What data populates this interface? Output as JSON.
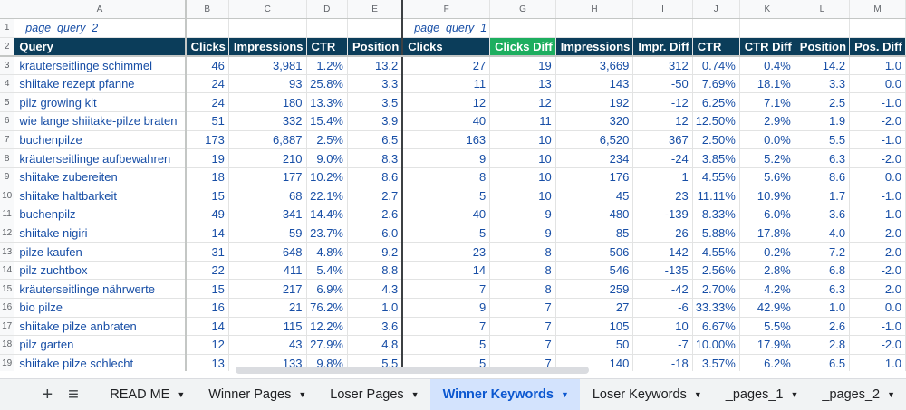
{
  "columns": [
    "A",
    "B",
    "C",
    "D",
    "E",
    "F",
    "G",
    "H",
    "I",
    "J",
    "K",
    "L",
    "M"
  ],
  "row_numbers": [
    "1",
    "2",
    "3",
    "4",
    "5",
    "6",
    "7",
    "8",
    "9",
    "10",
    "11",
    "12",
    "13",
    "14",
    "15",
    "16",
    "17",
    "18",
    "19"
  ],
  "labels": {
    "left": "_page_query_2",
    "right": "_page_query_1"
  },
  "headers": [
    "Query",
    "Clicks",
    "Impressions",
    "CTR",
    "Position",
    "Clicks",
    "Clicks Diff",
    "Impressions",
    "Impr. Diff",
    "CTR",
    "CTR Diff",
    "Position",
    "Pos. Diff"
  ],
  "rows": [
    [
      "kräuterseitlinge schimmel",
      "46",
      "3,981",
      "1.2%",
      "13.2",
      "27",
      "19",
      "3,669",
      "312",
      "0.74%",
      "0.4%",
      "14.2",
      "1.0"
    ],
    [
      "shiitake rezept pfanne",
      "24",
      "93",
      "25.8%",
      "3.3",
      "11",
      "13",
      "143",
      "-50",
      "7.69%",
      "18.1%",
      "3.3",
      "0.0"
    ],
    [
      "pilz growing kit",
      "24",
      "180",
      "13.3%",
      "3.5",
      "12",
      "12",
      "192",
      "-12",
      "6.25%",
      "7.1%",
      "2.5",
      "-1.0"
    ],
    [
      "wie lange shiitake-pilze braten",
      "51",
      "332",
      "15.4%",
      "3.9",
      "40",
      "11",
      "320",
      "12",
      "12.50%",
      "2.9%",
      "1.9",
      "-2.0"
    ],
    [
      "buchenpilze",
      "173",
      "6,887",
      "2.5%",
      "6.5",
      "163",
      "10",
      "6,520",
      "367",
      "2.50%",
      "0.0%",
      "5.5",
      "-1.0"
    ],
    [
      "kräuterseitlinge aufbewahren",
      "19",
      "210",
      "9.0%",
      "8.3",
      "9",
      "10",
      "234",
      "-24",
      "3.85%",
      "5.2%",
      "6.3",
      "-2.0"
    ],
    [
      "shiitake zubereiten",
      "18",
      "177",
      "10.2%",
      "8.6",
      "8",
      "10",
      "176",
      "1",
      "4.55%",
      "5.6%",
      "8.6",
      "0.0"
    ],
    [
      "shiitake haltbarkeit",
      "15",
      "68",
      "22.1%",
      "2.7",
      "5",
      "10",
      "45",
      "23",
      "11.11%",
      "10.9%",
      "1.7",
      "-1.0"
    ],
    [
      "buchenpilz",
      "49",
      "341",
      "14.4%",
      "2.6",
      "40",
      "9",
      "480",
      "-139",
      "8.33%",
      "6.0%",
      "3.6",
      "1.0"
    ],
    [
      "shiitake nigiri",
      "14",
      "59",
      "23.7%",
      "6.0",
      "5",
      "9",
      "85",
      "-26",
      "5.88%",
      "17.8%",
      "4.0",
      "-2.0"
    ],
    [
      "pilze kaufen",
      "31",
      "648",
      "4.8%",
      "9.2",
      "23",
      "8",
      "506",
      "142",
      "4.55%",
      "0.2%",
      "7.2",
      "-2.0"
    ],
    [
      "pilz zuchtbox",
      "22",
      "411",
      "5.4%",
      "8.8",
      "14",
      "8",
      "546",
      "-135",
      "2.56%",
      "2.8%",
      "6.8",
      "-2.0"
    ],
    [
      "kräuterseitlinge nährwerte",
      "15",
      "217",
      "6.9%",
      "4.3",
      "7",
      "8",
      "259",
      "-42",
      "2.70%",
      "4.2%",
      "6.3",
      "2.0"
    ],
    [
      "bio pilze",
      "16",
      "21",
      "76.2%",
      "1.0",
      "9",
      "7",
      "27",
      "-6",
      "33.33%",
      "42.9%",
      "1.0",
      "0.0"
    ],
    [
      "shiitake pilze anbraten",
      "14",
      "115",
      "12.2%",
      "3.6",
      "7",
      "7",
      "105",
      "10",
      "6.67%",
      "5.5%",
      "2.6",
      "-1.0"
    ],
    [
      "pilz garten",
      "12",
      "43",
      "27.9%",
      "4.8",
      "5",
      "7",
      "50",
      "-7",
      "10.00%",
      "17.9%",
      "2.8",
      "-2.0"
    ],
    [
      "shiitake pilze schlecht",
      "13",
      "133",
      "9.8%",
      "5.5",
      "5",
      "7",
      "140",
      "-18",
      "3.57%",
      "6.2%",
      "6.5",
      "1.0"
    ]
  ],
  "controls": {
    "add": "+",
    "menu": "≡"
  },
  "tabs": [
    {
      "label": "READ ME",
      "active": false
    },
    {
      "label": "Winner Pages",
      "active": false
    },
    {
      "label": "Loser Pages",
      "active": false
    },
    {
      "label": "Winner Keywords",
      "active": true
    },
    {
      "label": "Loser Keywords",
      "active": false
    },
    {
      "label": "_pages_1",
      "active": false
    },
    {
      "label": "_pages_2",
      "active": false
    }
  ],
  "colors": {
    "header_bg": "#0b3d5a",
    "clicks_diff_bg": "#1dae5f",
    "cell_text": "#174ea6",
    "active_tab": "#d3e3fd"
  },
  "icons": {
    "add": "plus-icon",
    "menu": "sheet-list-icon",
    "caret": "chevron-down-icon"
  }
}
